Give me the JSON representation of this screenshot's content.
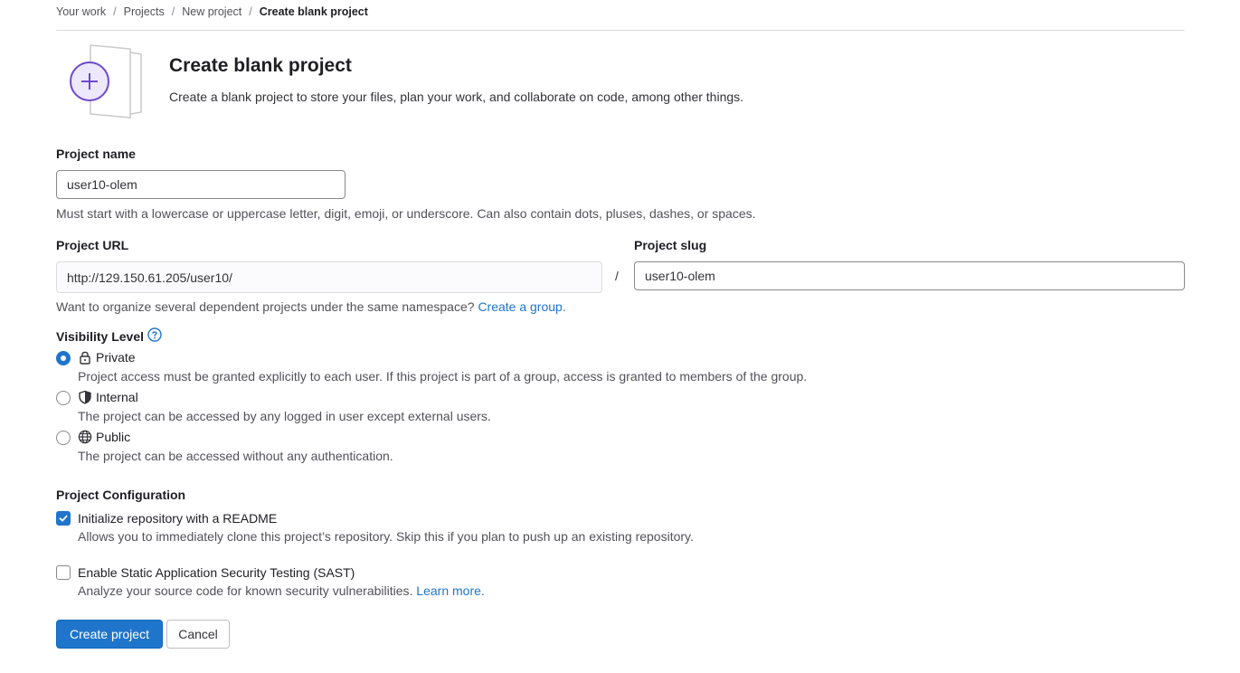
{
  "breadcrumb": {
    "items": [
      "Your work",
      "Projects",
      "New project"
    ],
    "current": "Create blank project",
    "separator": "/"
  },
  "hero": {
    "title": "Create blank project",
    "description": "Create a blank project to store your files, plan your work, and collaborate on code, among other things."
  },
  "form": {
    "project_name": {
      "label": "Project name",
      "value": "user10-olem",
      "help": "Must start with a lowercase or uppercase letter, digit, emoji, or underscore. Can also contain dots, pluses, dashes, or spaces."
    },
    "project_url": {
      "label": "Project URL",
      "value": "http://129.150.61.205/user10/",
      "separator": "/",
      "help_prefix": "Want to organize several dependent projects under the same namespace?",
      "help_link": "Create a group."
    },
    "project_slug": {
      "label": "Project slug",
      "value": "user10-olem"
    },
    "visibility": {
      "label": "Visibility Level",
      "options": [
        {
          "label": "Private",
          "icon": "lock-icon",
          "checked": true,
          "description": "Project access must be granted explicitly to each user. If this project is part of a group, access is granted to members of the group."
        },
        {
          "label": "Internal",
          "icon": "shield-icon",
          "checked": false,
          "description": "The project can be accessed by any logged in user except external users."
        },
        {
          "label": "Public",
          "icon": "globe-icon",
          "checked": false,
          "description": "The project can be accessed without any authentication."
        }
      ]
    },
    "configuration": {
      "label": "Project Configuration",
      "readme": {
        "label": "Initialize repository with a README",
        "checked": true,
        "description": "Allows you to immediately clone this project’s repository. Skip this if you plan to push up an existing repository."
      },
      "sast": {
        "label": "Enable Static Application Security Testing (SAST)",
        "checked": false,
        "description": "Analyze your source code for known security vulnerabilities.",
        "link": "Learn more."
      }
    }
  },
  "actions": {
    "create": "Create project",
    "cancel": "Cancel"
  },
  "colors": {
    "accent": "#1f75cb",
    "illustration": "#6e49cb",
    "link": "#1f75cb"
  }
}
